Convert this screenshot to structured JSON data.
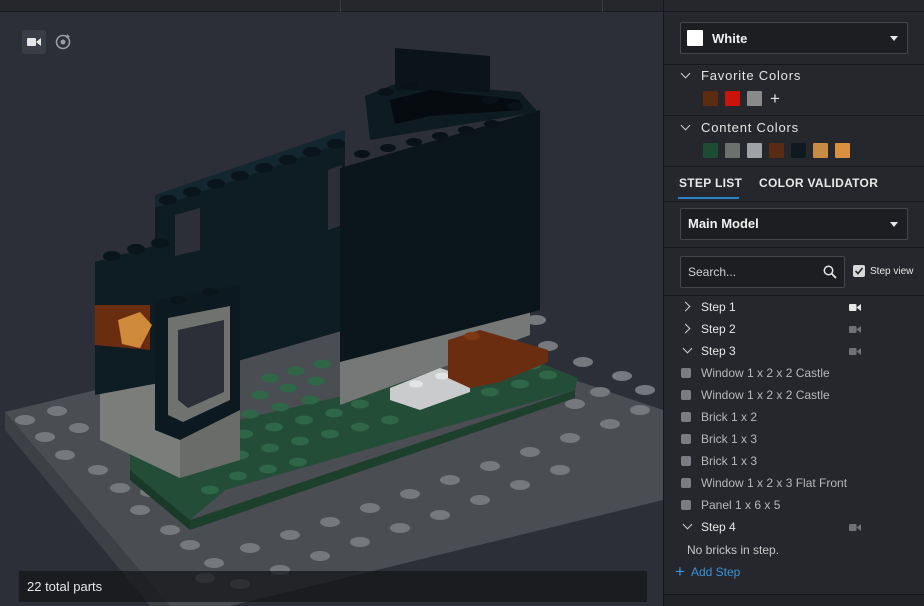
{
  "viewport": {
    "parts_count_text": "22 total parts"
  },
  "color_picker": {
    "selected_color_name": "White",
    "selected_color_hex": "#ffffff"
  },
  "favorite_colors": {
    "title": "Favorite Colors",
    "swatches": [
      "#5b2c12",
      "#c8140c",
      "#8a8a8a"
    ],
    "add_symbol": "+"
  },
  "content_colors": {
    "title": "Content Colors",
    "swatches": [
      "#1d4b33",
      "#6d716e",
      "#a0a3a6",
      "#5a2a12",
      "#0f1a20",
      "#c98a45",
      "#d9903f"
    ]
  },
  "tabs": {
    "step_list": "STEP LIST",
    "color_validator": "COLOR VALIDATOR"
  },
  "model_select": {
    "value": "Main Model"
  },
  "search": {
    "placeholder": "Search...",
    "step_view_label": "Step view",
    "step_view_checked": true
  },
  "steps": [
    {
      "label": "Step 1",
      "expanded": false
    },
    {
      "label": "Step 2",
      "expanded": false
    },
    {
      "label": "Step 3",
      "expanded": true,
      "parts": [
        "Window 1 x 2 x 2 Castle",
        "Window 1 x 2 x 2 Castle",
        "Brick 1 x 2",
        "Brick 1 x 3",
        "Brick 1 x 3",
        "Window 1 x 2 x 3 Flat Front",
        "Panel 1 x 6 x 5"
      ]
    },
    {
      "label": "Step 4",
      "expanded": true
    }
  ],
  "step4_empty_text": "No bricks in step.",
  "add_step_label": "Add Step"
}
